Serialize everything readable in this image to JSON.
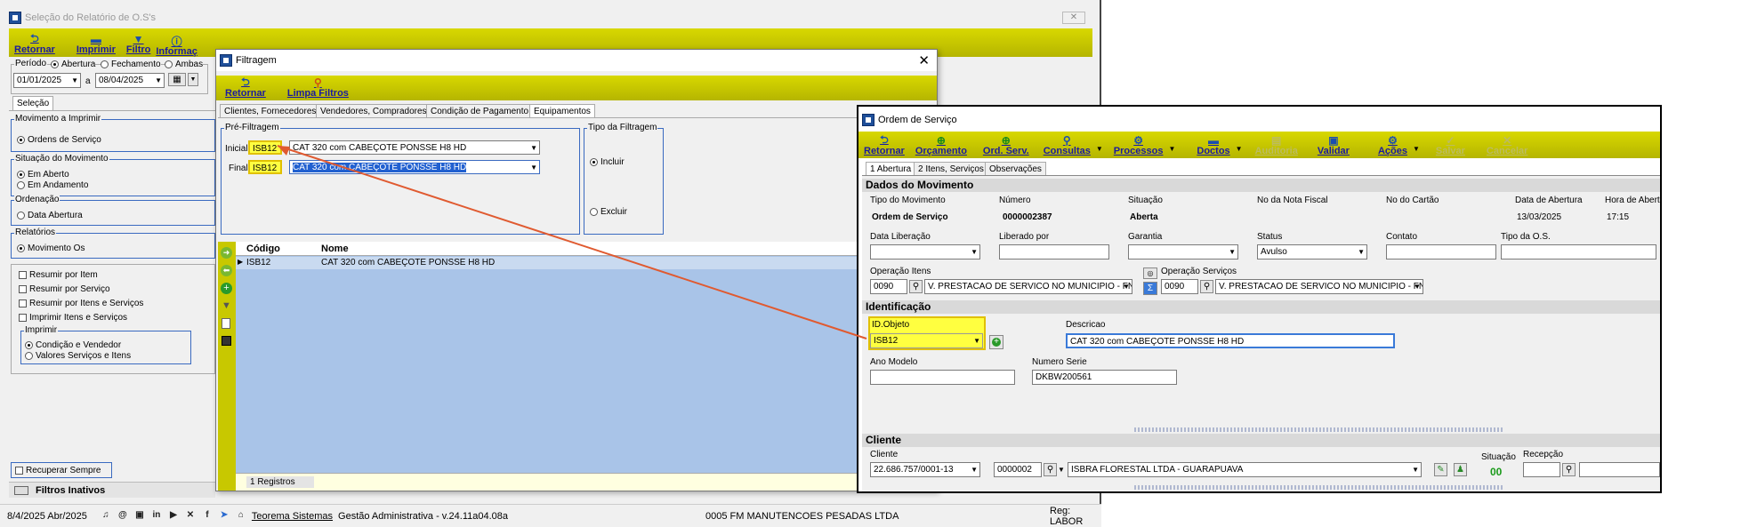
{
  "main_window": {
    "title": "Seleção do Relatório de O.S's",
    "toolbar": [
      "Retornar",
      "Imprimir",
      "Filtro",
      "Informaç"
    ],
    "periodo_label": "Período",
    "periodo_options": [
      "Abertura",
      "Fechamento",
      "Ambas"
    ],
    "date_from": "01/01/2025",
    "date_to": "08/04/2025",
    "date_sep": "a",
    "tab": "Seleção",
    "mov_title": "Movimento a Imprimir",
    "mov_option": "Ordens de Serviço",
    "sit_title": "Situação do Movimento",
    "sit_options": [
      "Em Aberto",
      "Em Andamento"
    ],
    "ord_title": "Ordenação",
    "ord_option": "Data Abertura",
    "rel_title": "Relatórios",
    "rel_option": "Movimento Os",
    "checks": [
      "Resumir por Item",
      "Resumir por Serviço",
      "Resumir por Itens e Serviços",
      "Imprimir Itens e Serviços"
    ],
    "imprimir_title": "Imprimir",
    "imprimir_options": [
      "Condição e Vendedor",
      "Valores Serviços e Itens"
    ],
    "recuperar": "Recuperar Sempre",
    "filtros_inativos": "Filtros Inativos"
  },
  "filtragem": {
    "title": "Filtragem",
    "toolbar": [
      "Retornar",
      "Limpa Filtros"
    ],
    "tabs": [
      "Clientes, Fornecedores",
      "Vendedores, Compradores",
      "Condição de Pagamento",
      "Equipamentos"
    ],
    "pre_title": "Pré-Filtragem",
    "inicial_label": "Inicial",
    "final_label": "Final",
    "code": "ISB12",
    "name": "CAT 320 com CABEÇOTE PONSSE H8 HD",
    "tipo_title": "Tipo da Filtragem",
    "tipo_options": [
      "Incluir",
      "Excluir"
    ],
    "grid_headers": [
      "Código",
      "Nome"
    ],
    "grid_rows": [
      {
        "code": "ISB12",
        "name": "CAT 320 com CABEÇOTE PONSSE H8 HD"
      }
    ],
    "registros": "1 Registros"
  },
  "os_window": {
    "title": "Ordem de Serviço",
    "toolbar": [
      "Retornar",
      "Orçamento",
      "Ord. Serv.",
      "Consultas",
      "Processos",
      "Doctos",
      "Auditoria",
      "Validar",
      "Ações",
      "Salvar",
      "Cancelar"
    ],
    "tabs": [
      "1 Abertura",
      "2 Itens, Serviços",
      "Observações"
    ],
    "sec1": "Dados do Movimento",
    "tipo_label": "Tipo do Movimento",
    "tipo_value": "Ordem de Serviço",
    "numero_label": "Número",
    "numero_value": "0000002387",
    "situacao_label": "Situação",
    "situacao_value": "Aberta",
    "nota_label": "No da Nota Fiscal",
    "cartao_label": "No do Cartão",
    "data_ab_label": "Data de Abertura",
    "data_ab_value": "13/03/2025",
    "hora_label": "Hora de Abert",
    "hora_value": "17:15",
    "data_lib_label": "Data Liberação",
    "lib_por_label": "Liberado por",
    "garantia_label": "Garantia",
    "status_label": "Status",
    "status_value": "Avulso",
    "contato_label": "Contato",
    "tipo_os_label": "Tipo da O.S.",
    "op_itens_label": "Operação Itens",
    "op_itens_code": "0090",
    "op_itens_desc": "V. PRESTACAO DE SERVICO NO MUNICIPIO - FN",
    "op_serv_label": "Operação Serviços",
    "op_serv_code": "0090",
    "op_serv_desc": "V. PRESTACAO DE SERVICO NO MUNICIPIO - FN",
    "sec2": "Identificação",
    "id_label": "ID.Objeto",
    "id_value": "ISB12",
    "desc_label": "Descricao",
    "desc_value": "CAT 320 com CABEÇOTE PONSSE H8 HD",
    "ano_label": "Ano Modelo",
    "serie_label": "Numero Serie",
    "serie_value": "DKBW200561",
    "sec3": "Cliente",
    "cliente_label": "Cliente",
    "cliente_cnpj": "22.686.757/0001-13",
    "cliente_code": "0000002",
    "cliente_name": "ISBRA FLORESTAL LTDA - GUARAPUAVA",
    "sit_label": "Situação",
    "sit_value": "00",
    "recepcao_label": "Recepção"
  },
  "statusbar": {
    "date": "8/4/2025 Abr/2025",
    "company_link": "Teorema Sistemas",
    "app": "Gestão Administrativa - v.24.11a04.08a",
    "firm": "0005 FM MANUTENCOES PESADAS LTDA",
    "reg": "Reg: LABOR"
  },
  "colors": {
    "toolbar": "#c8c800",
    "highlight": "#ffff40",
    "arrow": "#e05a30",
    "grid": "#a9c4e8",
    "frame_blue": "#3a6ac0"
  }
}
